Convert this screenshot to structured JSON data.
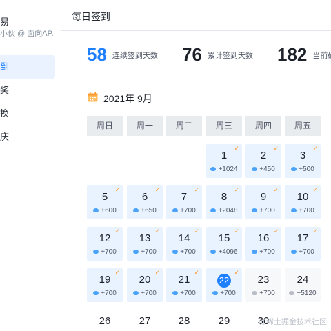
{
  "sidebar": {
    "user_name": "易",
    "user_desc": "小伙 @ 面向AP.",
    "items": [
      {
        "label": "到",
        "active": true
      },
      {
        "label": "奖",
        "active": false
      },
      {
        "label": "换",
        "active": false
      },
      {
        "label": "庆",
        "active": false
      }
    ]
  },
  "main": {
    "title": "每日签到",
    "stats": [
      {
        "value": "58",
        "label": "连续签到天数"
      },
      {
        "value": "76",
        "label": "累计签到天数"
      },
      {
        "value": "182",
        "label": "当前矿"
      }
    ],
    "month_title": "2021年 9月",
    "weekdays": [
      "周日",
      "周一",
      "周二",
      "周三",
      "周四",
      "周五"
    ],
    "calendar": [
      {
        "day": "1",
        "points": "+1024",
        "checked": true
      },
      {
        "day": "2",
        "points": "+450",
        "checked": true
      },
      {
        "day": "3",
        "points": "+500",
        "checked": true
      },
      {
        "day": "5",
        "points": "+600",
        "checked": true
      },
      {
        "day": "6",
        "points": "+650",
        "checked": true
      },
      {
        "day": "7",
        "points": "+700",
        "checked": true
      },
      {
        "day": "8",
        "points": "+2048",
        "checked": true
      },
      {
        "day": "9",
        "points": "+700",
        "checked": true
      },
      {
        "day": "10",
        "points": "+700",
        "checked": true
      },
      {
        "day": "12",
        "points": "+700",
        "checked": true
      },
      {
        "day": "13",
        "points": "+700",
        "checked": true
      },
      {
        "day": "14",
        "points": "+700",
        "checked": true
      },
      {
        "day": "15",
        "points": "+4096",
        "checked": true
      },
      {
        "day": "16",
        "points": "+700",
        "checked": true
      },
      {
        "day": "17",
        "points": "+700",
        "checked": true
      },
      {
        "day": "19",
        "points": "+700",
        "checked": true
      },
      {
        "day": "20",
        "points": "+700",
        "checked": true
      },
      {
        "day": "21",
        "points": "+700",
        "checked": true
      },
      {
        "day": "22",
        "points": "+700",
        "checked": true,
        "today": true
      },
      {
        "day": "23",
        "points": "+700",
        "checked": false
      },
      {
        "day": "24",
        "points": "+5120",
        "checked": false
      },
      {
        "day": "26",
        "points": "",
        "checked": false
      },
      {
        "day": "27",
        "points": "",
        "checked": false
      },
      {
        "day": "28",
        "points": "",
        "checked": false
      },
      {
        "day": "29",
        "points": "",
        "checked": false
      },
      {
        "day": "30",
        "points": "",
        "checked": false
      }
    ],
    "check_glyph": "✓"
  },
  "watermark": "@稀土掘金技术社区",
  "colors": {
    "accent": "#1e80ff",
    "checked_bg": "#e8f3ff",
    "check_mark": "#ff9a2e"
  }
}
